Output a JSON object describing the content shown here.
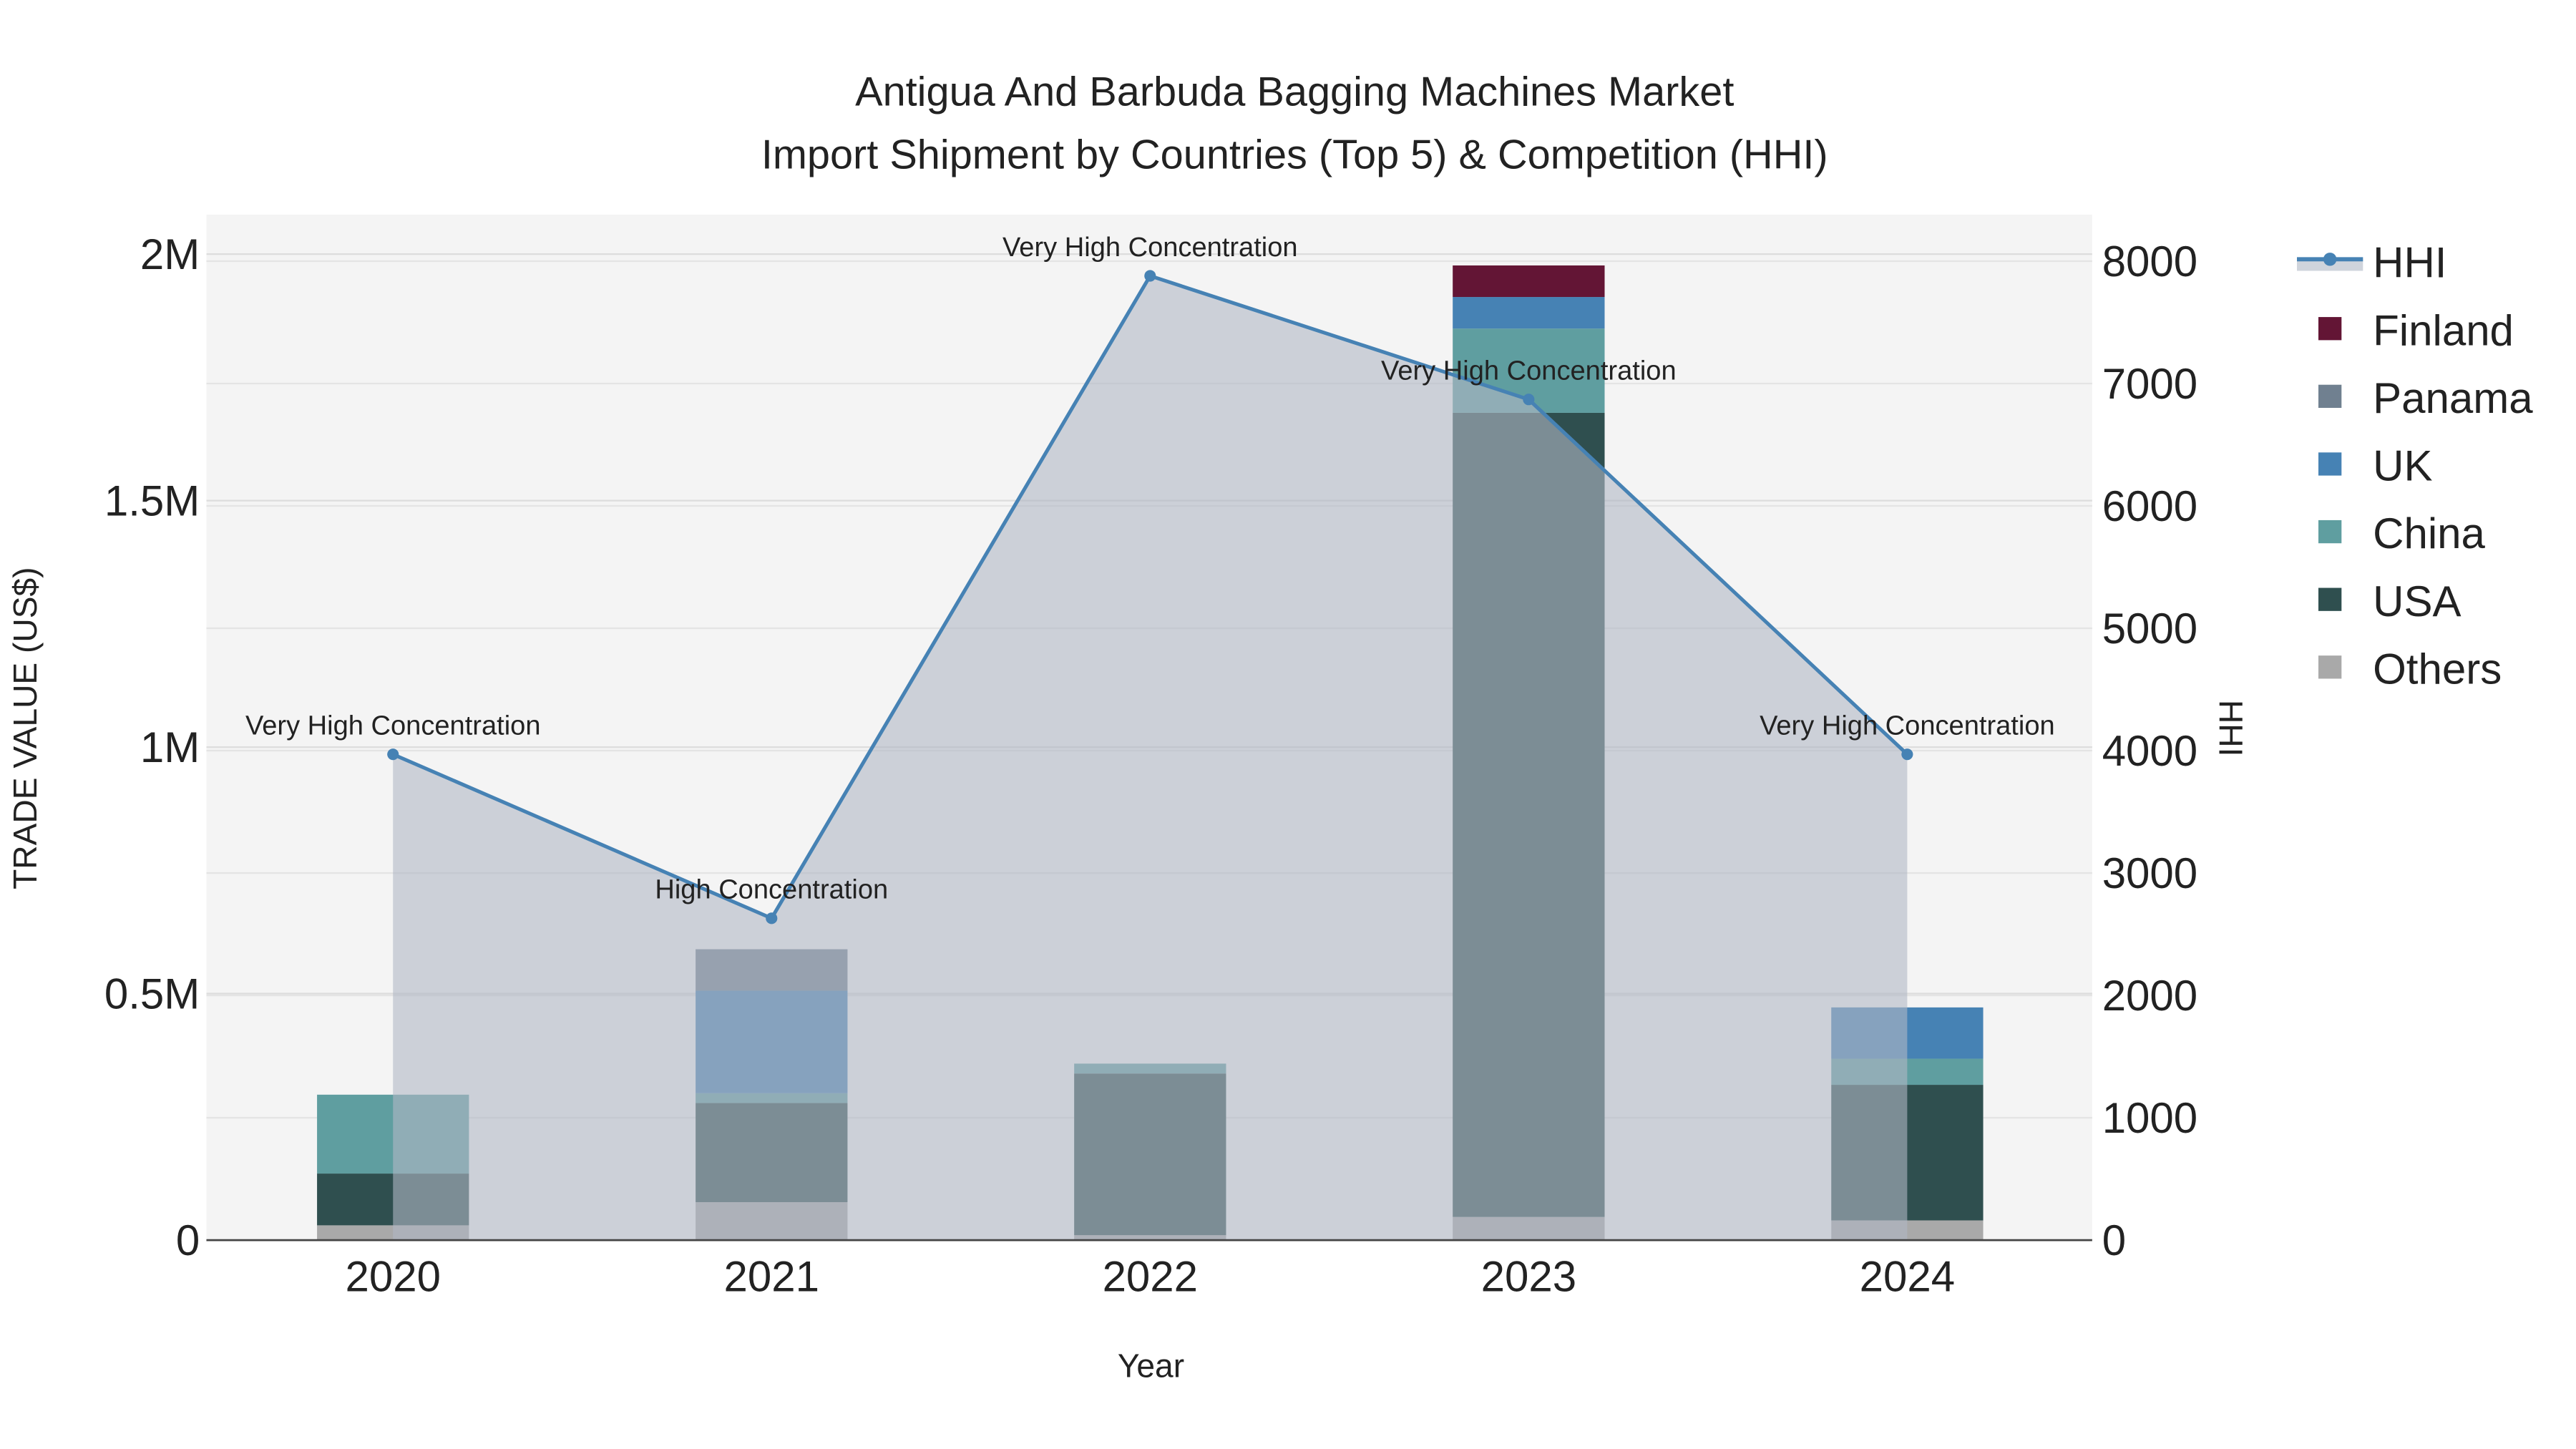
{
  "chart_data": {
    "type": "bar",
    "title": "Antigua And Barbuda Bagging Machines Market",
    "subtitle": "Import Shipment by Countries (Top 5) & Competition (HHI)",
    "xlabel": "Year",
    "ylabel": "TRADE VALUE (US$)",
    "y2label": "HHI",
    "categories": [
      "2020",
      "2021",
      "2022",
      "2023",
      "2024"
    ],
    "ylim": [
      0,
      2080000
    ],
    "y2lim": [
      0,
      8380
    ],
    "yticks": [
      {
        "v": 0,
        "label": "0"
      },
      {
        "v": 500000,
        "label": "0.5M"
      },
      {
        "v": 1000000,
        "label": "1M"
      },
      {
        "v": 1500000,
        "label": "1.5M"
      },
      {
        "v": 2000000,
        "label": "2M"
      }
    ],
    "y2ticks": [
      0,
      1000,
      2000,
      3000,
      4000,
      5000,
      6000,
      7000,
      8000
    ],
    "grid": true,
    "legend_position": "right",
    "series": [
      {
        "name": "Others",
        "color": "#A9A9A9",
        "values": [
          30000,
          77000,
          10000,
          47000,
          40000
        ]
      },
      {
        "name": "USA",
        "color": "#2F4F4F",
        "values": [
          105000,
          201000,
          328000,
          1631000,
          275000
        ]
      },
      {
        "name": "China",
        "color": "#5F9EA0",
        "values": [
          160000,
          20000,
          20000,
          171000,
          53000
        ]
      },
      {
        "name": "UK",
        "color": "#4682B4",
        "values": [
          0,
          208000,
          0,
          64000,
          104000
        ]
      },
      {
        "name": "Panama",
        "color": "#708090",
        "values": [
          0,
          84000,
          0,
          0,
          0
        ]
      },
      {
        "name": "Finland",
        "color": "#631535",
        "values": [
          0,
          0,
          0,
          64000,
          0
        ]
      }
    ],
    "hhi": {
      "name": "HHI",
      "color": "#4682B4",
      "values": [
        3970,
        2630,
        7880,
        6870,
        3970
      ],
      "labels": [
        "Very High Concentration",
        "High Concentration",
        "Very High Concentration",
        "Very High Concentration",
        "Very High Concentration"
      ]
    },
    "legend_order": [
      "HHI",
      "Finland",
      "Panama",
      "UK",
      "China",
      "USA",
      "Others"
    ]
  }
}
